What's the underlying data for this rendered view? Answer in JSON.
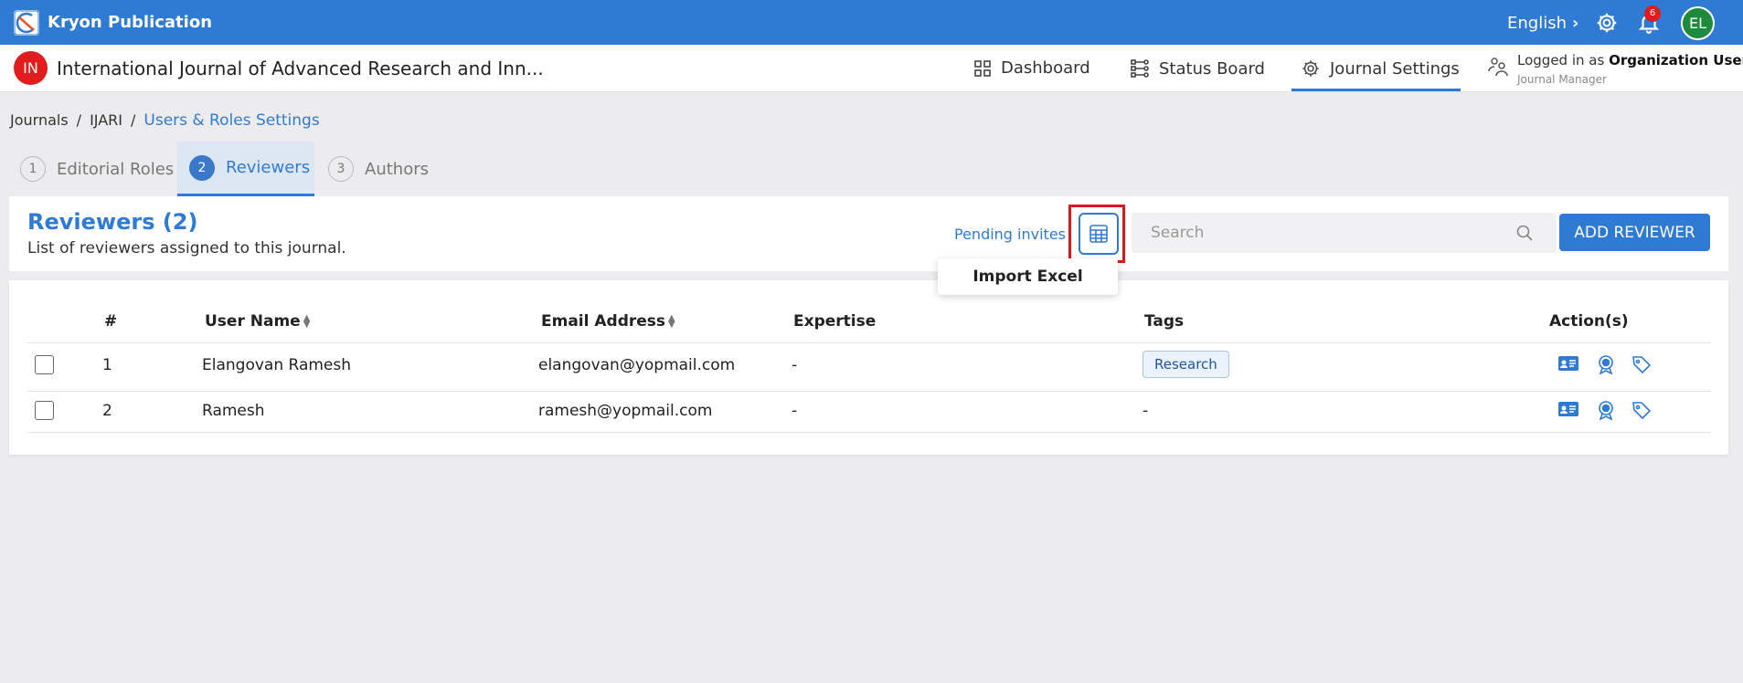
{
  "app": {
    "title": "Kryon Publication",
    "language": "English",
    "notification_count": "6",
    "user_initials": "EL"
  },
  "journal": {
    "badge": "IN",
    "title": "International Journal of Advanced Research and Inn...",
    "nav": [
      {
        "label": "Dashboard",
        "icon": "dashboard-icon"
      },
      {
        "label": "Status Board",
        "icon": "status-board-icon"
      },
      {
        "label": "Journal Settings",
        "icon": "settings-icon",
        "active": true
      }
    ],
    "login_prefix": "Logged in as",
    "login_user": "Organization User",
    "login_role": "Journal Manager"
  },
  "breadcrumb": {
    "items": [
      "Journals",
      "IJARI"
    ],
    "current": "Users & Roles Settings"
  },
  "tabs": [
    {
      "num": "1",
      "label": "Editorial Roles"
    },
    {
      "num": "2",
      "label": "Reviewers",
      "active": true
    },
    {
      "num": "3",
      "label": "Authors"
    }
  ],
  "reviewers": {
    "title": "Reviewers (2)",
    "subtitle": "List of reviewers assigned to this journal.",
    "pending_label": "Pending invites",
    "search_placeholder": "Search",
    "add_label": "ADD REVIEWER",
    "dropdown_item": "Import Excel"
  },
  "table": {
    "columns": [
      "#",
      "User Name",
      "Email Address",
      "Expertise",
      "Tags",
      "Action(s)"
    ],
    "rows": [
      {
        "num": "1",
        "name": "Elangovan Ramesh",
        "email": "elangovan@yopmail.com",
        "expertise": "-",
        "tag": "Research"
      },
      {
        "num": "2",
        "name": "Ramesh",
        "email": "ramesh@yopmail.com",
        "expertise": "-",
        "tag": "-"
      }
    ]
  },
  "colors": {
    "primary": "#2f7bd3",
    "highlight": "#e0161b",
    "journal_badge": "#e21c1c",
    "avatar": "#1e8a3e"
  }
}
